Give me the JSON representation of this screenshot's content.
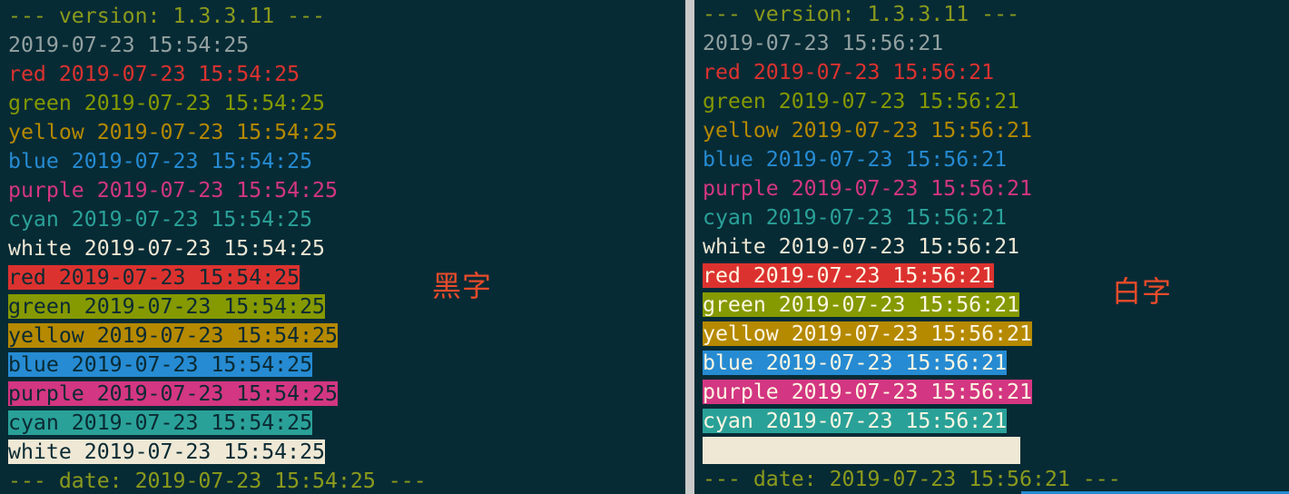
{
  "colors": {
    "background": "#072b35",
    "version_line": "#8b9a1c",
    "plain": "#93a1a1",
    "red": "#dc322f",
    "green": "#859900",
    "yellow": "#b58900",
    "blue": "#268bd2",
    "purple": "#d33682",
    "cyan": "#2aa198",
    "white": "#eee8d5",
    "annotation": "#ea4b2a"
  },
  "left": {
    "version_line": "--- version: 1.3.3.11 ---",
    "plain_line": "2019-07-23 15:54:25",
    "fg_lines": [
      "red 2019-07-23 15:54:25",
      "green 2019-07-23 15:54:25",
      "yellow 2019-07-23 15:54:25",
      "blue 2019-07-23 15:54:25",
      "purple 2019-07-23 15:54:25",
      "cyan 2019-07-23 15:54:25",
      "white 2019-07-23 15:54:25"
    ],
    "bg_lines": [
      "red 2019-07-23 15:54:25",
      "green 2019-07-23 15:54:25",
      "yellow 2019-07-23 15:54:25",
      "blue 2019-07-23 15:54:25",
      "purple 2019-07-23 15:54:25",
      "cyan 2019-07-23 15:54:25",
      "white 2019-07-23 15:54:25"
    ],
    "date_line": "--- date: 2019-07-23 15:54:25 ---",
    "annotation": "黑字"
  },
  "right": {
    "version_line": "--- version: 1.3.3.11 ---",
    "plain_line": "2019-07-23 15:56:21",
    "fg_lines": [
      "red 2019-07-23 15:56:21",
      "green 2019-07-23 15:56:21",
      "yellow 2019-07-23 15:56:21",
      "blue 2019-07-23 15:56:21",
      "purple 2019-07-23 15:56:21",
      "cyan 2019-07-23 15:56:21",
      "white 2019-07-23 15:56:21"
    ],
    "bg_lines": [
      "red 2019-07-23 15:56:21",
      "green 2019-07-23 15:56:21",
      "yellow 2019-07-23 15:56:21",
      "blue 2019-07-23 15:56:21",
      "purple 2019-07-23 15:56:21",
      "cyan 2019-07-23 15:56:21"
    ],
    "date_line": "--- date: 2019-07-23 15:56:21 ---",
    "annotation": "白字"
  }
}
